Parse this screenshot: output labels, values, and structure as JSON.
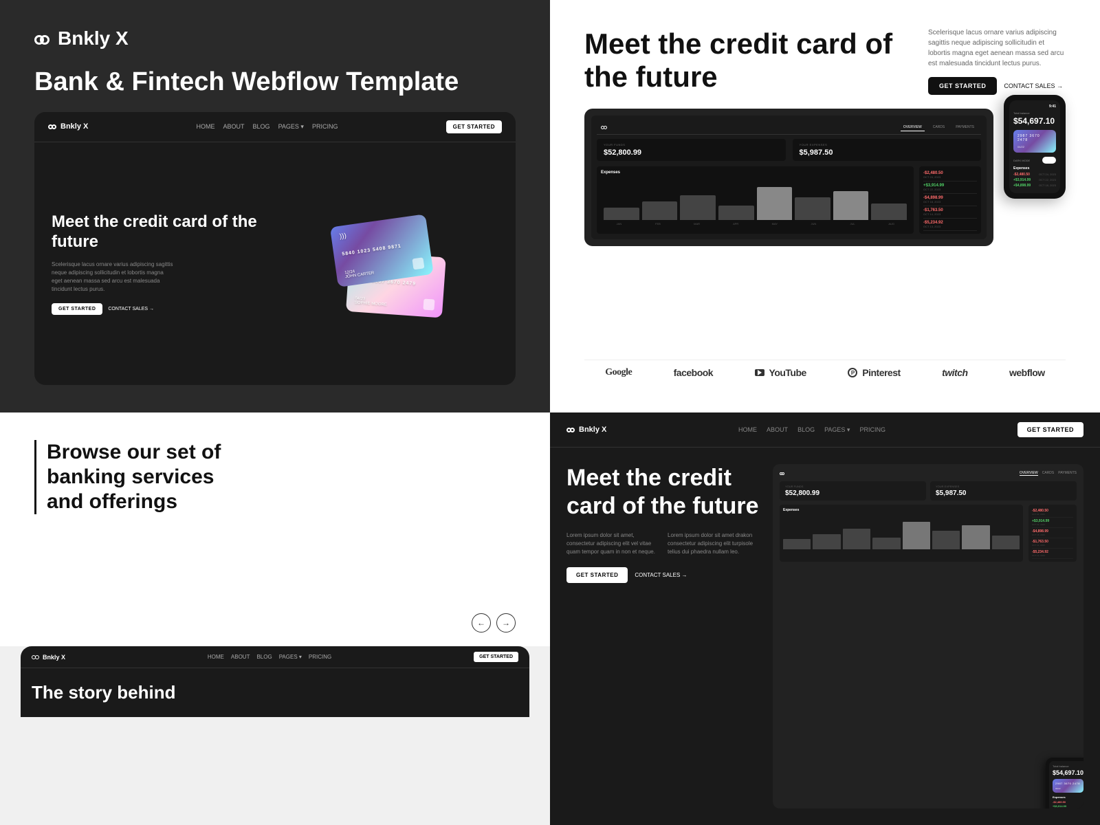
{
  "brand": {
    "name": "Bnkly X",
    "tagline": "Bank & Fintech Webflow Template"
  },
  "nav": {
    "links": [
      "HOME",
      "ABOUT",
      "BLOG",
      "PAGES ▾",
      "PRICING"
    ],
    "cta": "GET STARTED"
  },
  "hero": {
    "headline": "Meet the credit card of the future",
    "subtext": "Scelerisque lacus ornare varius adipiscing sagittis neque adipiscing sollicitudin et lobortis magna eget aenean massa sed arcu est malesuada tincidunt lectus purus.",
    "cta_primary": "GET STARTED",
    "cta_secondary": "CONTACT SALES →",
    "large_headline": "Meet the credit card of the future"
  },
  "dashboard": {
    "tabs": [
      "OVERVIEW",
      "CARDS",
      "PAYMENTS"
    ],
    "your_funds_label": "YOUR FUNDS",
    "your_expenses_label": "YOUR EXPENSES",
    "funds_value": "$52,800.99",
    "expenses_value": "$5,987.50",
    "expenses_title": "Expenses",
    "bar_months": [
      "JAN",
      "FEB",
      "MAR",
      "APR",
      "MAY",
      "JUN",
      "JUL",
      "AUG"
    ],
    "transactions": [
      {
        "amount": "-$2,480.50",
        "type": "negative",
        "date": "OCT 24, 2023"
      },
      {
        "amount": "+$3,914.99",
        "type": "positive",
        "date": "OCT 22, 2023"
      },
      {
        "amount": "-$4,898.99",
        "type": "negative",
        "date": "OCT 18, 2023"
      },
      {
        "amount": "-$1,763.50",
        "type": "negative",
        "date": "OCT 14, 2023"
      },
      {
        "amount": "-$5,234.92",
        "type": "negative",
        "date": "OCT 13, 2023"
      }
    ]
  },
  "phone": {
    "time": "9:41",
    "balance_label": "Total balance",
    "balance": "$54,697.10",
    "card_number": "2987 3670 2478",
    "card_date": "04/22",
    "card_name": "SOPHIE MOORE",
    "dark_mode_label": "DARK MODE",
    "expenses_label": "Expenses",
    "phone_transactions": [
      {
        "amount": "-$2,480.50",
        "date": "OCT 24, 2023"
      },
      {
        "amount": "+$3,914.99",
        "date": "OCT 22, 2023"
      },
      {
        "amount": "+$4,898.99",
        "date": "OCT 18, 2023"
      }
    ]
  },
  "cards": {
    "card1": {
      "number": "5840 1023 5408 9871",
      "date": "12/24",
      "name": "JOHN CARTER"
    },
    "card2": {
      "number": "3587 9807 3670 2479",
      "date": "04/23",
      "name": "SOPHIE MOORE"
    }
  },
  "logos": [
    {
      "name": "Google",
      "class": "google"
    },
    {
      "name": "facebook",
      "class": "facebook"
    },
    {
      "name": "▶ YouTube",
      "class": "youtube"
    },
    {
      "name": "⊕ Pinterest",
      "class": "pinterest"
    },
    {
      "name": "twitch",
      "class": "twitch"
    },
    {
      "name": "webflow",
      "class": "webflow"
    }
  ],
  "banking_section": {
    "title": "Browse our set of banking services and offerings"
  },
  "story_section": {
    "headline": "The story behind"
  },
  "bottom_right": {
    "desc1": "Lorem ipsum dolor sit amet, consectetur adipiscing elit vel vitae quam tempor quam in non et neque.",
    "desc2": "Lorem ipsum dolor sit amet drakon consectetur adipiscing elit turpisole telius dui phaedra nullam leo."
  }
}
